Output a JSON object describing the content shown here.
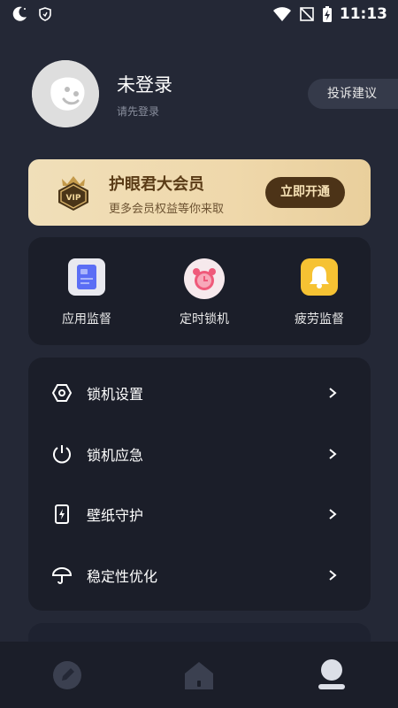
{
  "status_bar": {
    "time": "11:13",
    "left_icons": [
      "moon-icon",
      "shield-icon"
    ],
    "right_icons": [
      "wifi-icon",
      "no-signal-icon",
      "battery-charging-icon"
    ]
  },
  "profile": {
    "title": "未登录",
    "subtitle": "请先登录",
    "avatar_icon": "avatar-face-icon"
  },
  "feedback": {
    "label": "投诉建议"
  },
  "vip": {
    "badge_text": "VIP",
    "title": "护眼君大会员",
    "subtitle": "更多会员权益等你来取",
    "button": "立即开通"
  },
  "features": [
    {
      "label": "应用监督",
      "icon": "document-icon",
      "color": "#5b6ef5"
    },
    {
      "label": "定时锁机",
      "icon": "alarm-clock-icon",
      "color": "#ef5a7a"
    },
    {
      "label": "疲劳监督",
      "icon": "bell-icon",
      "color": "#f6c233"
    }
  ],
  "menu": [
    {
      "label": "锁机设置",
      "icon": "hexagon-settings-icon"
    },
    {
      "label": "锁机应急",
      "icon": "power-icon"
    },
    {
      "label": "壁纸守护",
      "icon": "phone-lightning-icon"
    },
    {
      "label": "稳定性优化",
      "icon": "umbrella-icon"
    }
  ],
  "bottom_nav": [
    {
      "name": "pen",
      "icon": "pen-icon",
      "active": false
    },
    {
      "name": "home",
      "icon": "home-icon",
      "active": false
    },
    {
      "name": "profile",
      "icon": "person-icon",
      "active": true
    }
  ],
  "colors": {
    "background": "#242836",
    "card": "#1b1e29",
    "vip_gold": "#efd8ab",
    "vip_brown": "#4c3317",
    "text_secondary": "#8a8f9e"
  }
}
